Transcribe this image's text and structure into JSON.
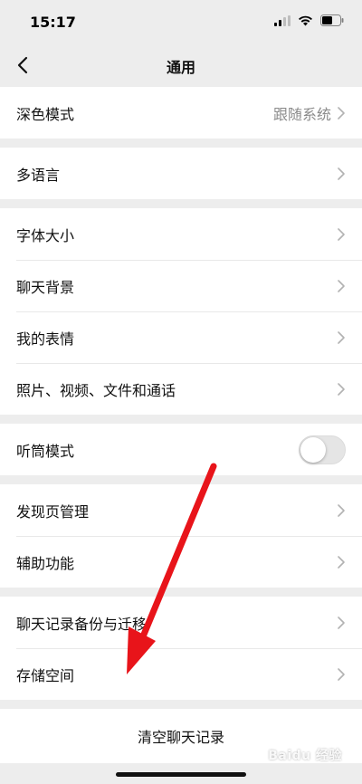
{
  "status": {
    "time": "15:17"
  },
  "nav": {
    "title": "通用"
  },
  "groups": [
    {
      "items": [
        {
          "label": "深色模式",
          "value": "跟随系统"
        }
      ]
    },
    {
      "items": [
        {
          "label": "多语言"
        }
      ]
    },
    {
      "items": [
        {
          "label": "字体大小"
        },
        {
          "label": "聊天背景"
        },
        {
          "label": "我的表情"
        },
        {
          "label": "照片、视频、文件和通话"
        }
      ]
    },
    {
      "items": [
        {
          "label": "听筒模式",
          "toggle_on": false
        }
      ]
    },
    {
      "items": [
        {
          "label": "发现页管理"
        },
        {
          "label": "辅助功能"
        }
      ]
    },
    {
      "items": [
        {
          "label": "聊天记录备份与迁移"
        },
        {
          "label": "存储空间"
        }
      ]
    }
  ],
  "clear_history": {
    "label": "清空聊天记录"
  },
  "watermark": {
    "text": "Baidu 经验"
  },
  "colors": {
    "background": "#ededed",
    "arrow": "#e8141a",
    "chevron": "#b2b2b2"
  }
}
